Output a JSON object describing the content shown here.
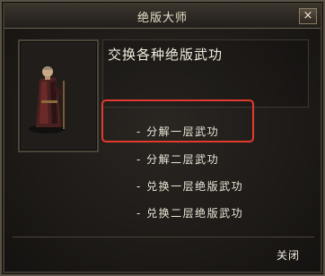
{
  "dialog": {
    "title": "绝版大师",
    "close_symbol": "×",
    "description": "交换各种绝版武功",
    "options": [
      "- 分解一层武功",
      "- 分解二层武功",
      "- 兑换一层绝版武功",
      "- 兑换二层绝版武功"
    ],
    "close_label": "关闭",
    "portrait": "npc-master-portrait",
    "highlight_color": "#e23a2e"
  }
}
